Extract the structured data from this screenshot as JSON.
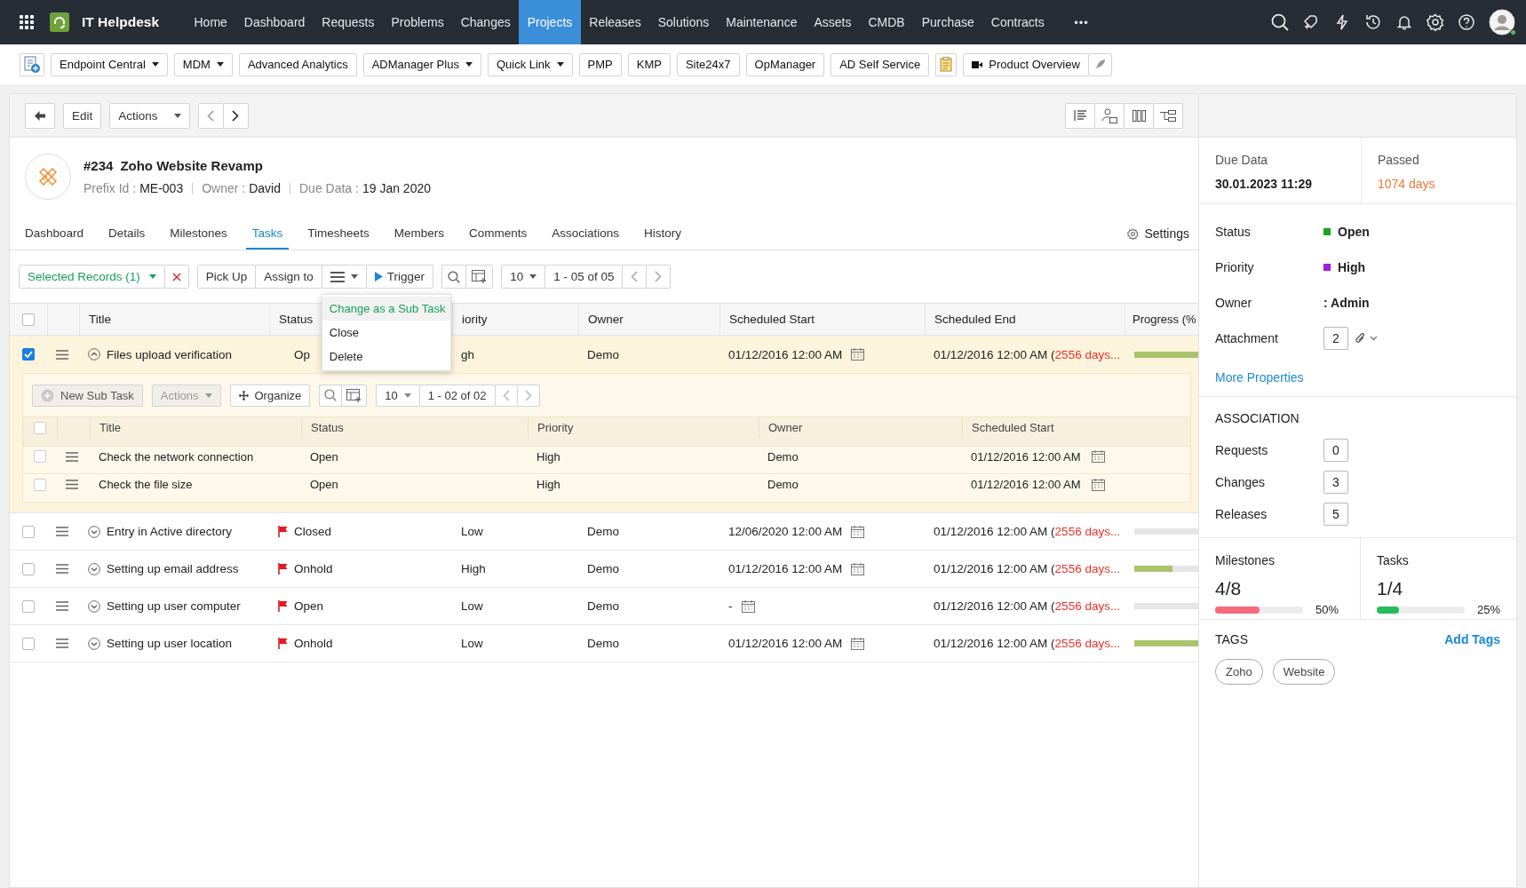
{
  "nav": {
    "app_name": "IT Helpdesk",
    "more": "•••",
    "items": [
      {
        "label": "Home",
        "selected": false
      },
      {
        "label": "Dashboard",
        "selected": false
      },
      {
        "label": "Requests",
        "selected": false
      },
      {
        "label": "Problems",
        "selected": false
      },
      {
        "label": "Changes",
        "selected": false
      },
      {
        "label": "Projects",
        "selected": true
      },
      {
        "label": "Releases",
        "selected": false
      },
      {
        "label": "Solutions",
        "selected": false
      },
      {
        "label": "Maintenance",
        "selected": false
      },
      {
        "label": "Assets",
        "selected": false
      },
      {
        "label": "CMDB",
        "selected": false
      },
      {
        "label": "Purchase",
        "selected": false
      },
      {
        "label": "Contracts",
        "selected": false
      }
    ]
  },
  "quick_links": [
    {
      "label": "Endpoint Central",
      "kind": "link",
      "dropdown": true
    },
    {
      "label": "MDM",
      "kind": "link",
      "dropdown": true
    },
    {
      "label": "Advanced Analytics",
      "kind": "link",
      "dropdown": false
    },
    {
      "label": "ADManager Plus",
      "kind": "link",
      "dropdown": true
    },
    {
      "label": "Quick Link",
      "kind": "link",
      "dropdown": true
    },
    {
      "label": "PMP",
      "kind": "link",
      "dropdown": false
    },
    {
      "label": "KMP",
      "kind": "link",
      "dropdown": false
    },
    {
      "label": "Site24x7",
      "kind": "link",
      "dropdown": false
    },
    {
      "label": "OpManager",
      "kind": "link",
      "dropdown": false
    },
    {
      "label": "AD Self Service",
      "kind": "link",
      "dropdown": false
    },
    {
      "label": "Product Overview",
      "kind": "video",
      "dropdown": false
    }
  ],
  "toolbar": {
    "edit": "Edit",
    "actions": "Actions"
  },
  "project": {
    "number": "#234",
    "title": "Zoho Website Revamp",
    "meta": [
      {
        "label": "Prefix Id :",
        "value": "ME-003"
      },
      {
        "label": "Owner :",
        "value": "David"
      },
      {
        "label": "Due Data :",
        "value": "19 Jan 2020"
      }
    ]
  },
  "tabs": {
    "settings": "Settings",
    "items": [
      {
        "label": "Dashboard",
        "selected": false
      },
      {
        "label": "Details",
        "selected": false
      },
      {
        "label": "Milestones",
        "selected": false
      },
      {
        "label": "Tasks",
        "selected": true
      },
      {
        "label": "Timesheets",
        "selected": false
      },
      {
        "label": "Members",
        "selected": false
      },
      {
        "label": "Comments",
        "selected": false
      },
      {
        "label": "Associations",
        "selected": false
      },
      {
        "label": "History",
        "selected": false
      }
    ]
  },
  "task_toolbar": {
    "selected_records": "Selected Records (1)",
    "pick_up": "Pick Up",
    "assign_to": "Assign to",
    "trigger": "Trigger",
    "page_size": "10",
    "range": "1 - 05 of 05"
  },
  "action_menu": {
    "items": [
      {
        "label": "Change as a Sub Task",
        "selected": true
      },
      {
        "label": "Close",
        "selected": false
      },
      {
        "label": "Delete",
        "selected": false
      }
    ]
  },
  "table": {
    "all_checked": false,
    "columns": [
      "Title",
      "Status",
      "iority",
      "Owner",
      "Scheduled Start",
      "Scheduled End",
      "Progress (%"
    ],
    "rows": [
      {
        "title": "Files upload verification",
        "checked": true,
        "expanded": true,
        "flag": false,
        "status": "Op",
        "priority": "gh",
        "owner": "Demo",
        "start": "01/12/2016 12:00 AM",
        "end": "01/12/2016 12:00 AM (",
        "overdue": "2556 days...",
        "level": 1,
        "subtasks": {
          "new_button": "New Sub Task",
          "actions": {
            "label": "Actions",
            "disabled": true
          },
          "organize": "Organize",
          "page_size": "10",
          "range": "1 - 02 of 02",
          "all_checked": false,
          "columns": [
            "Title",
            "Status",
            "Priority",
            "Owner",
            "Scheduled Start"
          ],
          "rows": [
            {
              "title": "Check the network connection",
              "checked": false,
              "status": "Open",
              "priority": "High",
              "owner": "Demo",
              "start": "01/12/2016 12:00 AM"
            },
            {
              "title": "Check the file size",
              "checked": false,
              "status": "Open",
              "priority": "High",
              "owner": "Demo",
              "start": "01/12/2016 12:00 AM"
            }
          ]
        }
      },
      {
        "title": "Entry in Active directory",
        "checked": false,
        "expanded": false,
        "flag": true,
        "status": "Closed",
        "priority": "Low",
        "owner": "Demo",
        "start": "12/06/2020 12:00 AM",
        "end": "01/12/2016 12:00 AM (",
        "overdue": "2556 days...",
        "level": 0
      },
      {
        "title": "Setting up email address",
        "checked": false,
        "expanded": false,
        "flag": true,
        "status": "Onhold",
        "priority": "High",
        "owner": "Demo",
        "start": "01/12/2016 12:00 AM",
        "end": "01/12/2016 12:00 AM (",
        "overdue": "2556 days...",
        "level": 0.6
      },
      {
        "title": "Setting up user computer",
        "checked": false,
        "expanded": false,
        "flag": true,
        "status": "Open",
        "priority": "Low",
        "owner": "Demo",
        "start": "-",
        "end": "01/12/2016 12:00 AM (",
        "overdue": "2556 days...",
        "level": 0
      },
      {
        "title": "Setting up user location",
        "checked": false,
        "expanded": false,
        "flag": true,
        "status": "Onhold",
        "priority": "Low",
        "owner": "Demo",
        "start": "01/12/2016 12:00 AM",
        "end": "01/12/2016 12:00 AM (",
        "overdue": "2556 days...",
        "level": 1
      }
    ]
  },
  "side": {
    "due": {
      "label": "Due Data",
      "value": "30.01.2023 11:29"
    },
    "passed": {
      "label": "Passed",
      "value": "1074 days"
    },
    "properties": [
      {
        "label": "Status",
        "kind": "dot",
        "value": "Open",
        "color": "#1aa51a"
      },
      {
        "label": "Priority",
        "kind": "dot",
        "value": "High",
        "color": "#a21de0"
      },
      {
        "label": "Owner",
        "kind": "text",
        "value": ": Admin"
      },
      {
        "label": "Attachment",
        "kind": "count",
        "value": "2"
      }
    ],
    "more_properties": "More Properties",
    "association": {
      "title": "ASSOCIATION",
      "items": [
        {
          "label": "Requests",
          "count": "0"
        },
        {
          "label": "Changes",
          "count": "3"
        },
        {
          "label": "Releases",
          "count": "5"
        }
      ]
    },
    "progress": [
      {
        "label": "Milestones",
        "value": "4/8",
        "level": 0.5,
        "percent": "50%",
        "color": "#f46a7e"
      },
      {
        "label": "Tasks",
        "value": "1/4",
        "level": 0.25,
        "percent": "25%",
        "color": "#27ba5e"
      }
    ],
    "tags": {
      "title": "TAGS",
      "add": "Add Tags",
      "items": [
        "Zoho",
        "Website"
      ]
    }
  }
}
